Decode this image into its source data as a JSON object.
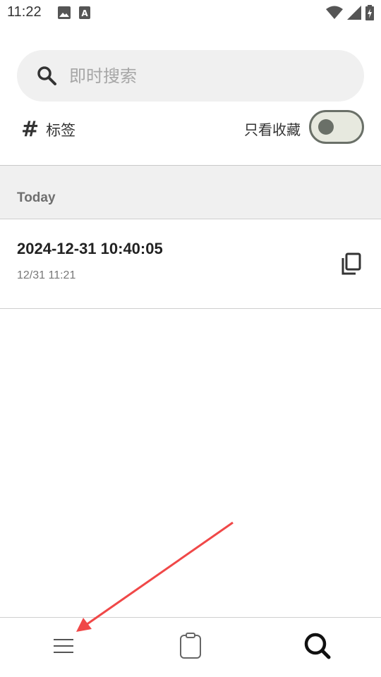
{
  "status_bar": {
    "time": "11:22",
    "left_icons": [
      "image-icon",
      "font-a-icon"
    ],
    "right_icons": [
      "wifi-icon",
      "signal-icon",
      "battery-icon"
    ]
  },
  "search": {
    "placeholder": "即时搜索",
    "value": "",
    "icon": "search-icon"
  },
  "filters": {
    "tag_icon": "hash-icon",
    "tag_label": "标签",
    "favorites_label": "只看收藏",
    "favorites_only": false
  },
  "list": {
    "section_title": "Today",
    "items": [
      {
        "title": "2024-12-31 10:40:05",
        "time": "12/31 11:21",
        "action_icon": "copy-icon"
      }
    ]
  },
  "bottom_nav": {
    "items": [
      {
        "icon": "menu-icon",
        "active": false
      },
      {
        "icon": "clipboard-icon",
        "active": false
      },
      {
        "icon": "search-icon",
        "active": true
      }
    ]
  },
  "colors": {
    "annotation_arrow": "#f04848",
    "search_bg": "#f0f0f0",
    "toggle_accent": "#6a7068"
  }
}
